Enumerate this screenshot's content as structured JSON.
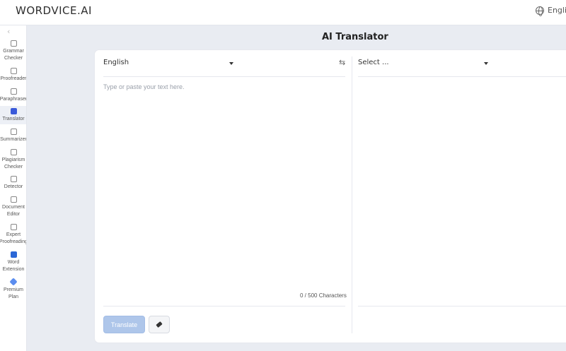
{
  "header": {
    "logo": "WORDVICE.AI",
    "language": "Englis"
  },
  "sidebar": {
    "items": [
      {
        "label": "Grammar\nChecker",
        "icon": "grammar-checker-icon"
      },
      {
        "label": "Proofreader",
        "icon": "proofreader-icon"
      },
      {
        "label": "Paraphraser",
        "icon": "paraphraser-icon"
      },
      {
        "label": "Translator",
        "icon": "translator-icon",
        "active": true
      },
      {
        "label": "Summarizer",
        "icon": "summarizer-icon"
      },
      {
        "label": "Plagiarism\nChecker",
        "icon": "plagiarism-checker-icon"
      },
      {
        "label": "Detector",
        "icon": "ai-detector-icon"
      },
      {
        "label": "Document\nEditor",
        "icon": "document-editor-icon"
      },
      {
        "label": "Expert\nProofreading",
        "icon": "expert-proofreading-icon"
      },
      {
        "label": "Word\nExtension",
        "icon": "word-extension-icon"
      },
      {
        "label": "Premium\nPlan",
        "icon": "premium-plan-icon"
      }
    ]
  },
  "main": {
    "title": "AI Translator",
    "source_language": "English",
    "target_language": "Select ...",
    "source_placeholder": "Type or paste your text here.",
    "char_counter": "0 / 500 Characters",
    "translate_label": "Translate"
  },
  "colors": {
    "accent": "#3a5ad9",
    "translate_button_disabled": "#aec6ea",
    "background": "#e9ecf2"
  }
}
